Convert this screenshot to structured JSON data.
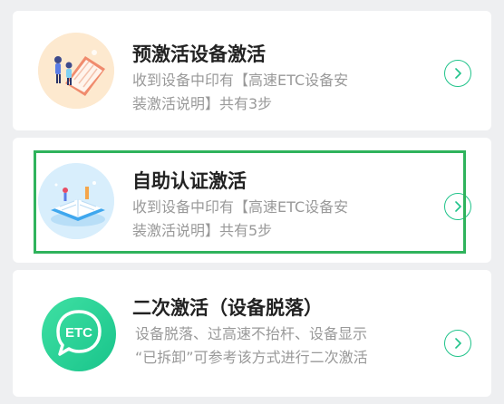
{
  "options": [
    {
      "title": "预激活设备激活",
      "desc_line1": "收到设备中印有【高速ETC设备安",
      "desc_line2": "装激活说明】共有3步",
      "icon": "device-pre-activation-illustration"
    },
    {
      "title": "自助认证激活",
      "desc_line1": "收到设备中印有【高速ETC设备安",
      "desc_line2": "装激活说明】共有5步",
      "icon": "self-certification-illustration",
      "selected": true
    },
    {
      "title": "二次激活（设备脱落）",
      "desc_line1": "设备脱落、过高速不抬杆、设备显示",
      "desc_line2": "“已拆卸”可参考该方式进行二次激活",
      "icon": "etc-icon",
      "icon_text": "ETC"
    }
  ],
  "colors": {
    "accent": "#20c38a",
    "highlight_border": "#2fb35c",
    "title": "#222222",
    "desc": "#999999",
    "background": "#eeeff1"
  }
}
